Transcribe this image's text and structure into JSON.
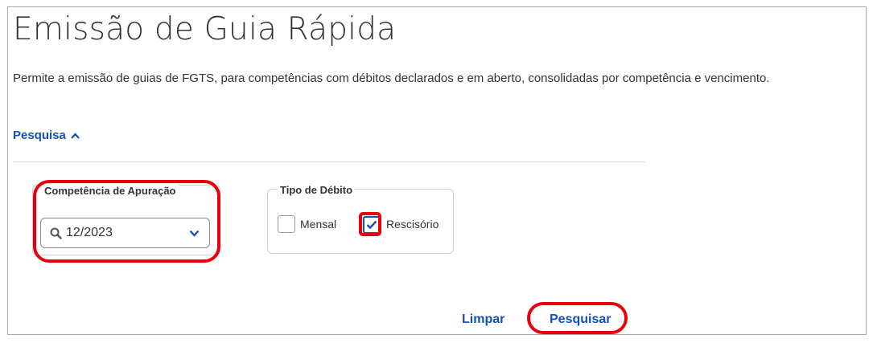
{
  "page": {
    "title": "Emissão de Guia Rápida",
    "description": "Permite a emissão de guias de FGTS, para competências com débitos declarados e em aberto, consolidadas por competência e vencimento."
  },
  "search_section": {
    "toggle_label": "Pesquisa",
    "toggle_icon": "chevron-up-icon",
    "expanded": true
  },
  "competencia": {
    "label": "Competência de Apuração",
    "value": "12/2023",
    "icons": [
      "search-icon",
      "chevron-down-icon"
    ]
  },
  "tipo_debito": {
    "label": "Tipo de Débito",
    "options": [
      {
        "label": "Mensal",
        "checked": false
      },
      {
        "label": "Rescisório",
        "checked": true
      }
    ]
  },
  "actions": {
    "clear_label": "Limpar",
    "search_label": "Pesquisar"
  },
  "colors": {
    "primary_blue": "#1351b4",
    "highlight_red": "#e8000b",
    "text": "#333333"
  }
}
